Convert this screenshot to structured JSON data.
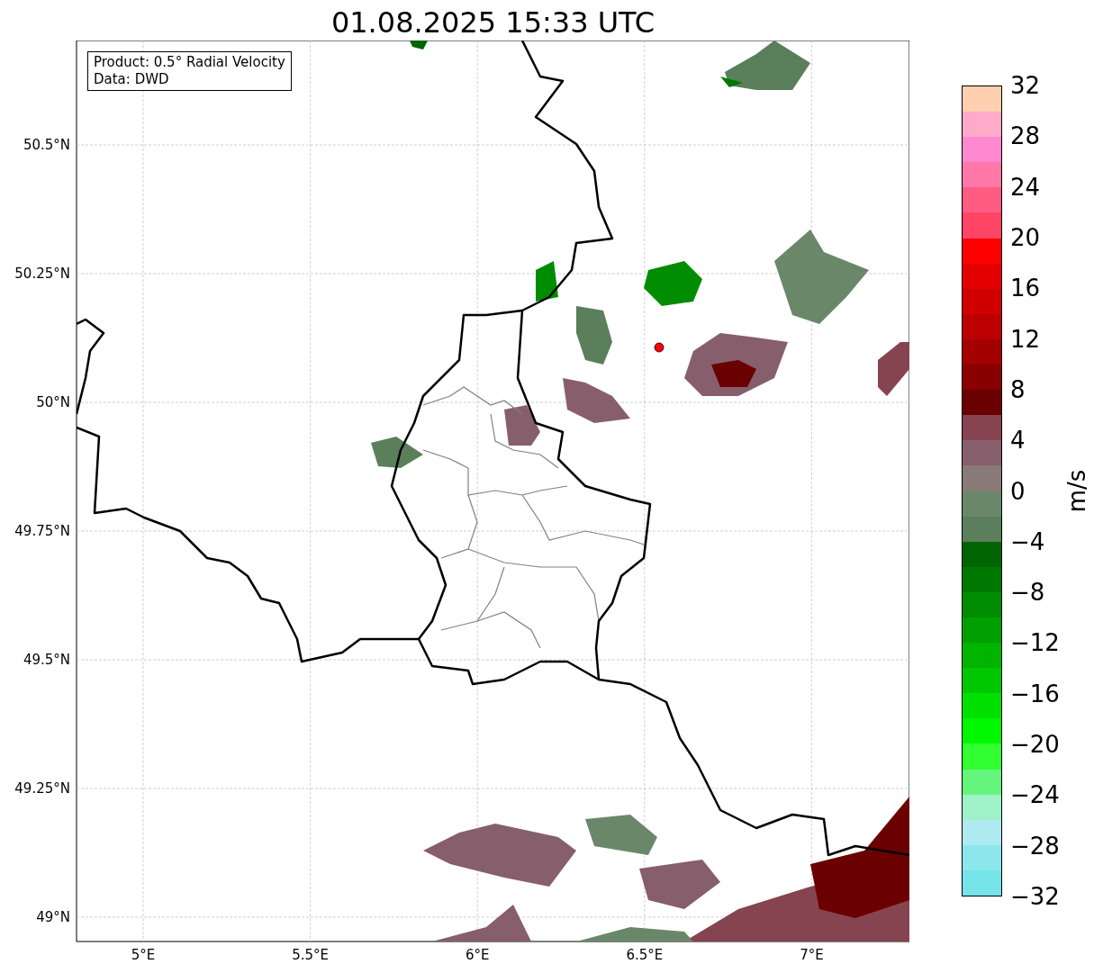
{
  "title": "01.08.2025 15:33 UTC",
  "legend": [
    "Product: 0.5° Radial Velocity",
    "Data: DWD"
  ],
  "map": {
    "lat_ticks": [
      "50.5°N",
      "50.25°N",
      "50°N",
      "49.75°N",
      "49.5°N",
      "49.25°N",
      "49°N"
    ],
    "lon_ticks": [
      "5°E",
      "5.5°E",
      "6°E",
      "6.5°E",
      "7°E"
    ]
  },
  "colorbar": {
    "label": "m/s",
    "ticks": [
      "32",
      "28",
      "24",
      "20",
      "16",
      "12",
      "8",
      "4",
      "0",
      "−4",
      "−8",
      "−12",
      "−16",
      "−20",
      "−24",
      "−28",
      "−32"
    ],
    "bands": [
      {
        "color": "#ffcfb0"
      },
      {
        "color": "#ffaac8"
      },
      {
        "color": "#ff88d0"
      },
      {
        "color": "#ff78a8"
      },
      {
        "color": "#ff5c84"
      },
      {
        "color": "#ff4464"
      },
      {
        "color": "#ff0000"
      },
      {
        "color": "#e40000"
      },
      {
        "color": "#d00000"
      },
      {
        "color": "#bc0000"
      },
      {
        "color": "#a40000"
      },
      {
        "color": "#8a0000"
      },
      {
        "color": "#6a0000"
      },
      {
        "color": "#854450"
      },
      {
        "color": "#875e6c"
      },
      {
        "color": "#8a7a78"
      },
      {
        "color": "#6a876a"
      },
      {
        "color": "#5a7f5a"
      },
      {
        "color": "#006400"
      },
      {
        "color": "#007800"
      },
      {
        "color": "#008c00"
      },
      {
        "color": "#00a000"
      },
      {
        "color": "#00b400"
      },
      {
        "color": "#00c800"
      },
      {
        "color": "#00e000"
      },
      {
        "color": "#00f800"
      },
      {
        "color": "#33ff33"
      },
      {
        "color": "#66f57c"
      },
      {
        "color": "#9ef2c8"
      },
      {
        "color": "#aeeaf0"
      },
      {
        "color": "#8ce8ec"
      },
      {
        "color": "#76e4e8"
      }
    ]
  }
}
